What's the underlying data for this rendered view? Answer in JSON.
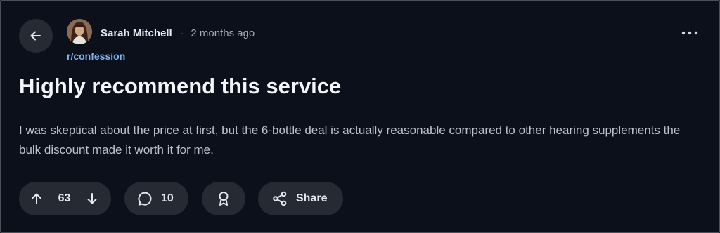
{
  "post": {
    "author": "Sarah Mitchell",
    "separator": "·",
    "time": "2 months ago",
    "subreddit": "r/confession",
    "title": "Highly recommend this service",
    "body": "I was skeptical about the price at first, but the 6-bottle deal is actually reasonable compared to other hearing supplements the bulk discount made it worth it for me."
  },
  "actions": {
    "upvotes": "63",
    "comments": "10",
    "share_label": "Share"
  },
  "icons": {
    "back": "arrow-left-icon",
    "more": "more-horizontal-icon",
    "upvote": "arrow-up-icon",
    "downvote": "arrow-down-icon",
    "comment": "speech-bubble-icon",
    "award": "award-ribbon-icon",
    "share": "share-nodes-icon"
  },
  "colors": {
    "background": "#0b101a",
    "pill": "#252a33",
    "subreddit_link": "#7fb2f0"
  }
}
